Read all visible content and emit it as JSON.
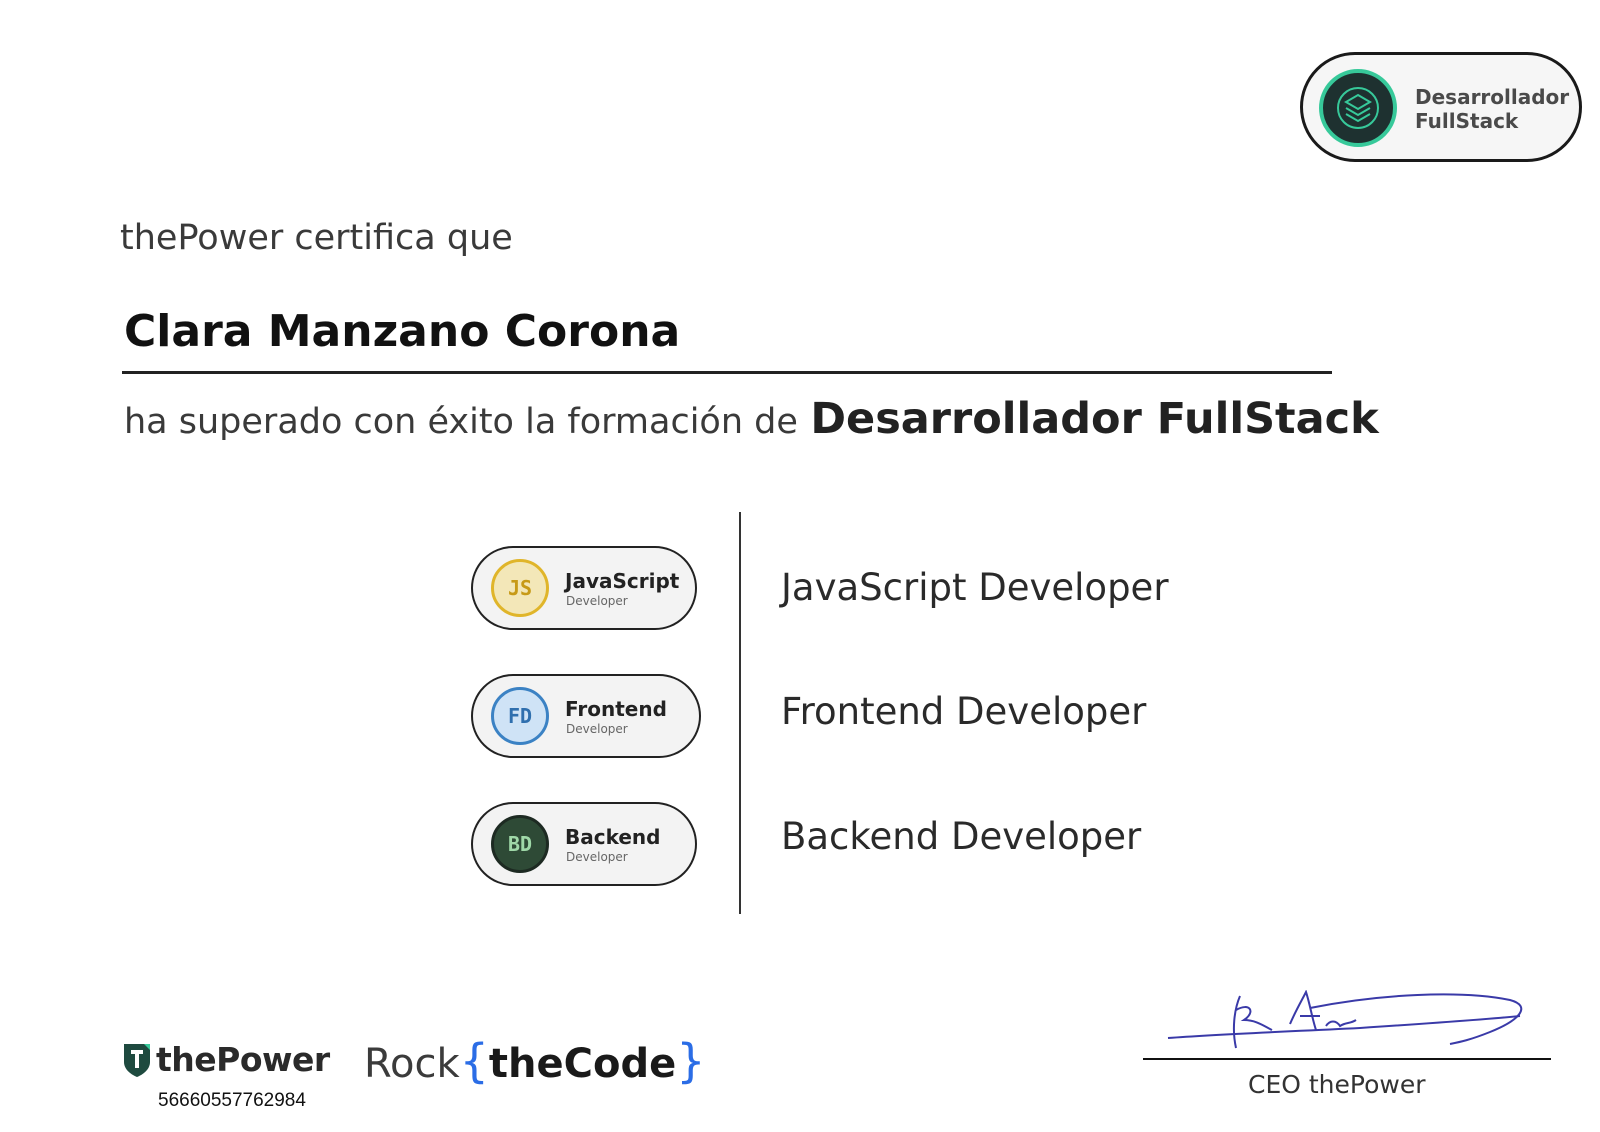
{
  "top_badge": {
    "line1": "Desarrollador",
    "line2": "FullStack",
    "icon": "layers-stack-icon"
  },
  "intro": "thePower certifica que",
  "recipient": "Clara Manzano Corona",
  "sentence": {
    "lead": "ha superado con éxito la formación de",
    "course": "Desarrollador FullStack"
  },
  "badges": [
    {
      "title": "JavaScript",
      "subtitle": "Developer",
      "icon_text": "JS",
      "icon": "javascript-shield-icon",
      "color": "#e0b52a"
    },
    {
      "title": "Frontend",
      "subtitle": "Developer",
      "icon_text": "FD",
      "icon": "frontend-shield-icon",
      "color": "#3b82c4"
    },
    {
      "title": "Backend",
      "subtitle": "Developer",
      "icon_text": "BD",
      "icon": "backend-shield-icon",
      "color": "#2e5e3e"
    }
  ],
  "skills": [
    "JavaScript Developer",
    "Frontend Developer",
    "Backend Developer"
  ],
  "footer": {
    "thepower_logo": "thePower",
    "certificate_id": "56660557762984",
    "rockthecode": {
      "rock": "Rock",
      "open": "{",
      "code": "theCode",
      "close": "}"
    },
    "signature_caption": "CEO thePower"
  }
}
